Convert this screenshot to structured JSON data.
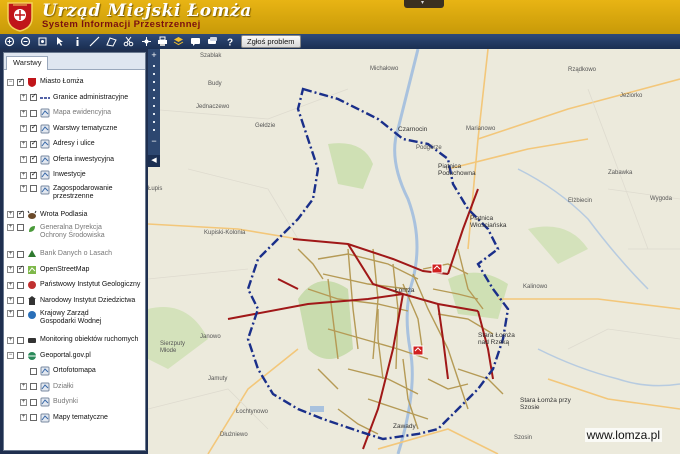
{
  "header": {
    "title": "Urząd Miejski Łomża",
    "subtitle": "System Informacji Przestrzennej",
    "tab_glyph": "▾"
  },
  "toolbar": {
    "report_label": "Zgłoś problem",
    "icons": [
      "zoom-in-icon",
      "zoom-out-icon",
      "zoom-extent-icon",
      "pointer-icon",
      "info-icon",
      "measure-line-icon",
      "measure-area-icon",
      "scissors-icon",
      "pan-icon",
      "print-icon",
      "layers-icon",
      "comment-icon",
      "chat-icon",
      "help-icon"
    ]
  },
  "panel": {
    "tab_label": "Warstwy",
    "layers": [
      {
        "label": "Miasto Łomża",
        "checked": true,
        "level": 0,
        "icon": "crest-icon",
        "expand": "−"
      },
      {
        "label": "Granice administracyjne",
        "checked": true,
        "level": 1,
        "icon": "boundary-icon",
        "expand": "+"
      },
      {
        "label": "Mapa ewidencyjna",
        "checked": false,
        "level": 1,
        "icon": "cadastre-icon",
        "expand": "+",
        "grey": true
      },
      {
        "label": "Warstwy tematyczne",
        "checked": true,
        "level": 1,
        "icon": "thematic-icon",
        "expand": "+"
      },
      {
        "label": "Adresy i ulice",
        "checked": true,
        "level": 1,
        "icon": "address-icon",
        "expand": "+"
      },
      {
        "label": "Oferta inwestycyjna",
        "checked": true,
        "level": 1,
        "icon": "offer-icon",
        "expand": "+"
      },
      {
        "label": "Inwestycje",
        "checked": true,
        "level": 1,
        "icon": "investment-icon",
        "expand": "+"
      },
      {
        "label": "Zagospodarowanie przestrzenne",
        "checked": false,
        "level": 1,
        "icon": "zoning-icon",
        "expand": "+",
        "tall": true
      },
      {
        "label": "Wrota Podlasia",
        "checked": true,
        "level": 0,
        "icon": "bison-icon",
        "expand": "+"
      },
      {
        "label": "Generalna Dyrekcja Ochrony Środowiska",
        "checked": false,
        "level": 0,
        "icon": "leaf-icon",
        "expand": "+",
        "grey": true,
        "tall": true
      },
      {
        "label": "Bank Danych o Lasach",
        "checked": false,
        "level": 0,
        "icon": "forest-icon",
        "expand": "+",
        "grey": true
      },
      {
        "label": "OpenStreetMap",
        "checked": true,
        "level": 0,
        "icon": "osm-icon",
        "expand": "+"
      },
      {
        "label": "Państwowy Instytut Geologiczny",
        "checked": false,
        "level": 0,
        "icon": "geology-icon",
        "expand": "+"
      },
      {
        "label": "Narodowy Instytut Dziedzictwa",
        "checked": false,
        "level": 0,
        "icon": "heritage-icon",
        "expand": "+"
      },
      {
        "label": "Krajowy Zarząd Gospodarki Wodnej",
        "checked": false,
        "level": 0,
        "icon": "water-icon",
        "expand": "+",
        "tall": true
      },
      {
        "label": "Monitoring obiektów ruchomych",
        "checked": false,
        "level": 0,
        "icon": "monitoring-icon",
        "expand": "+"
      },
      {
        "label": "Geoportal.gov.pl",
        "checked": false,
        "level": 0,
        "icon": "geoportal-icon",
        "expand": "−"
      },
      {
        "label": "Ortofotomapa",
        "checked": false,
        "level": 1,
        "icon": "ortho-icon",
        "expand": ""
      },
      {
        "label": "Działki",
        "checked": false,
        "level": 1,
        "icon": "parcel-icon",
        "expand": "+",
        "grey": true
      },
      {
        "label": "Budynki",
        "checked": false,
        "level": 1,
        "icon": "building-icon",
        "expand": "+",
        "grey": true
      },
      {
        "label": "Mapy tematyczne",
        "checked": false,
        "level": 1,
        "icon": "thematic-maps-icon",
        "expand": "+"
      }
    ]
  },
  "map": {
    "place_labels": [
      "Szablak",
      "Michałowo",
      "Rządkowo",
      "Budy",
      "Jeziorko",
      "Jednaczewo",
      "Gełdzie",
      "Czarnocin",
      "Marianowo",
      "Podgórze",
      "Piątnica Poduchowna",
      "Zabawka",
      "Piątnica Włościańska",
      "Elżbiecin",
      "Wygoda",
      "Łupis",
      "Kupiski-Kolonia",
      "Łomża",
      "Kalinowo",
      "Janowo",
      "Stara Łomża nad Rzeką",
      "Sierzputy Młode",
      "Jamuty",
      "Łochtynowo",
      "Stara Łomża przy Szosie",
      "Zawady",
      "Dłużniewo",
      "Łochtynowo",
      "Szosin"
    ],
    "watermark": "www.lomza.pl",
    "boundary_color": "#1a2f8a",
    "road_color": "#a01818",
    "street_color": "#b59a55"
  }
}
